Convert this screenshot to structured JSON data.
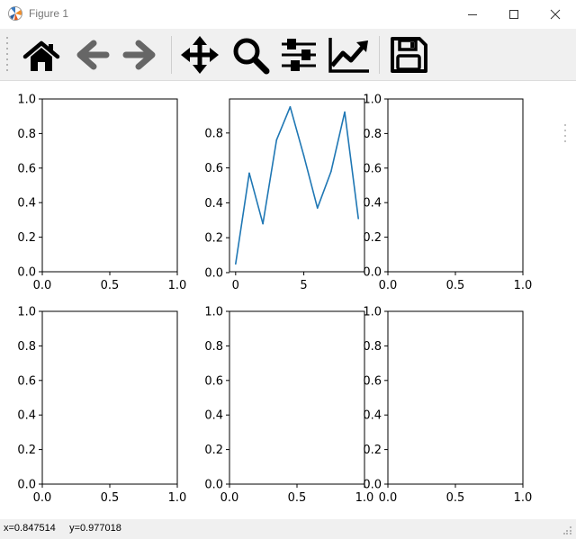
{
  "window": {
    "title": "Figure 1"
  },
  "toolbar": {
    "buttons": [
      "home",
      "back",
      "forward",
      "pan",
      "zoom",
      "configure-subplots",
      "edit-axes",
      "save"
    ]
  },
  "status": {
    "coords_text": "x=0.847514     y=0.977018"
  },
  "colors": {
    "line": "#1f77b4",
    "icon": "#000000",
    "icon_disabled": "#666666"
  },
  "chart_data": [
    {
      "type": "line",
      "position": "row1-col1",
      "x": [],
      "series": [],
      "xlim": [
        0,
        1
      ],
      "ylim": [
        0,
        1
      ],
      "xticks": [
        "0.0",
        "0.5",
        "1.0"
      ],
      "yticks": [
        "0.0",
        "0.2",
        "0.4",
        "0.6",
        "0.8",
        "1.0"
      ]
    },
    {
      "type": "line",
      "position": "row1-col2",
      "x": [
        0,
        1,
        2,
        3,
        4,
        5,
        6,
        7,
        8,
        9
      ],
      "series": [
        {
          "values": [
            0.05,
            0.57,
            0.28,
            0.76,
            0.95,
            0.67,
            0.37,
            0.58,
            0.92,
            0.31
          ]
        }
      ],
      "xlim": [
        -0.45,
        9.45
      ],
      "ylim": [
        0.005,
        0.995
      ],
      "xticks": [
        "0",
        "5"
      ],
      "yticks": [
        "0.0",
        "0.2",
        "0.4",
        "0.6",
        "0.8"
      ]
    },
    {
      "type": "line",
      "position": "row1-col3",
      "x": [],
      "series": [],
      "xlim": [
        0,
        1
      ],
      "ylim": [
        0,
        1
      ],
      "xticks": [
        "0.0",
        "0.5",
        "1.0"
      ],
      "yticks": [
        "0.0",
        "0.2",
        "0.4",
        "0.6",
        "0.8",
        "1.0"
      ]
    },
    {
      "type": "line",
      "position": "row2-col1",
      "x": [],
      "series": [],
      "xlim": [
        0,
        1
      ],
      "ylim": [
        0,
        1
      ],
      "xticks": [
        "0.0",
        "0.5",
        "1.0"
      ],
      "yticks": [
        "0.0",
        "0.2",
        "0.4",
        "0.6",
        "0.8",
        "1.0"
      ]
    },
    {
      "type": "line",
      "position": "row2-col2",
      "x": [],
      "series": [],
      "xlim": [
        0,
        1
      ],
      "ylim": [
        0,
        1
      ],
      "xticks": [
        "0.0",
        "0.5",
        "1.0"
      ],
      "yticks": [
        "0.0",
        "0.2",
        "0.4",
        "0.6",
        "0.8",
        "1.0"
      ]
    },
    {
      "type": "line",
      "position": "row2-col3",
      "x": [],
      "series": [],
      "xlim": [
        0,
        1
      ],
      "ylim": [
        0,
        1
      ],
      "xticks": [
        "0.0",
        "0.5",
        "1.0"
      ],
      "yticks": [
        "0.0",
        "0.2",
        "0.4",
        "0.6",
        "0.8",
        "1.0"
      ]
    }
  ]
}
